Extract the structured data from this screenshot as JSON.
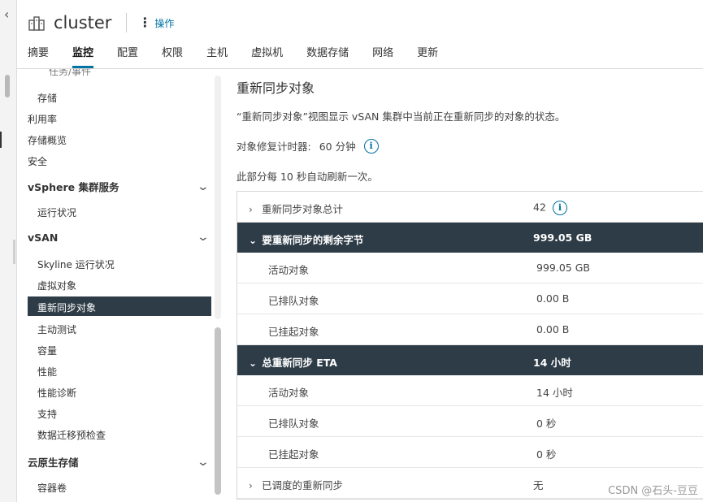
{
  "header": {
    "title": "cluster",
    "actions_label": "操作",
    "icons": {
      "cluster": "cluster-icon",
      "actions": "vertical-dots-icon"
    }
  },
  "tabs": [
    {
      "label": "摘要"
    },
    {
      "label": "监控",
      "active": true
    },
    {
      "label": "配置"
    },
    {
      "label": "权限"
    },
    {
      "label": "主机"
    },
    {
      "label": "虚拟机"
    },
    {
      "label": "数据存储"
    },
    {
      "label": "网络"
    },
    {
      "label": "更新"
    }
  ],
  "sidebar": {
    "cut_item": "任务/事件",
    "items": {
      "storage": "存储",
      "utilization": "利用率",
      "storage_overview": "存储概览",
      "security": "安全",
      "run_status": "运行状况",
      "skyline": "Skyline 运行状况",
      "virtual_objects": "虚拟对象",
      "resync": "重新同步对象",
      "proactive_tests": "主动测试",
      "capacity": "容量",
      "performance": "性能",
      "perf_diagnostics": "性能诊断",
      "support": "支持",
      "data_migration": "数据迁移预检查",
      "container_volumes": "容器卷"
    },
    "sections": {
      "vsphere": "vSphere 集群服务",
      "vsan": "vSAN",
      "cloud_native": "云原生存储"
    }
  },
  "main": {
    "title": "重新同步对象",
    "description": "“重新同步对象”视图显示 vSAN 集群中当前正在重新同步的对象的状态。",
    "timer_label": "对象修复计时器:",
    "timer_value": "60 分钟",
    "refresh_note": "此部分每 10 秒自动刷新一次。",
    "rows": {
      "total_label": "重新同步对象总计",
      "total_value": "42",
      "bytes_label": "要重新同步的剩余字节",
      "bytes_value": "999.05 GB",
      "bytes_active_label": "活动对象",
      "bytes_active_value": "999.05 GB",
      "bytes_queued_label": "已排队对象",
      "bytes_queued_value": "0.00 B",
      "bytes_suspended_label": "已挂起对象",
      "bytes_suspended_value": "0.00 B",
      "eta_label": "总重新同步 ETA",
      "eta_value": "14 小时",
      "eta_active_label": "活动对象",
      "eta_active_value": "14 小时",
      "eta_queued_label": "已排队对象",
      "eta_queued_value": "0 秒",
      "eta_suspended_label": "已挂起对象",
      "eta_suspended_value": "0 秒",
      "scheduled_label": "已调度的重新同步",
      "scheduled_value": "无"
    }
  },
  "watermark": "CSDN @石头-豆豆",
  "colors": {
    "accent": "#0072a3",
    "selected_bg": "#2e3c47"
  }
}
